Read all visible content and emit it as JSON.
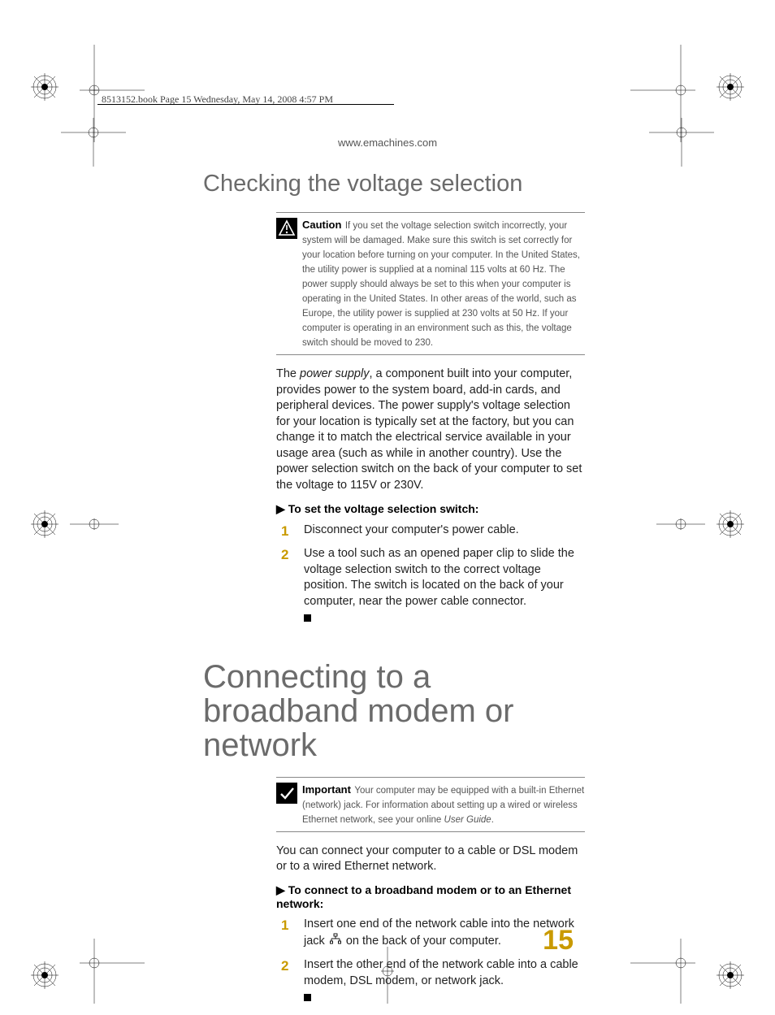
{
  "header": {
    "running": "8513152.book  Page 15  Wednesday, May 14, 2008  4:57 PM",
    "url": "www.emachines.com"
  },
  "section_voltage": {
    "title": "Checking the voltage selection",
    "callout": {
      "label": "Caution",
      "body_lead": " If you set the voltage selection switch incorrectly, your system will be damaged. Make sure this switch is set correctly for your location before turning on your computer. In the United States, the utility power is supplied at a nominal 115 volts at 60 Hz. The power supply should always be set to this when your computer is operating in the United States. In other areas of the world, such as Europe, the utility power is supplied at 230 volts at 50 Hz. If your computer is operating in an environment such as this, the voltage switch should be moved to 230."
    },
    "para_pre": "The ",
    "para_ital": "power supply",
    "para_post": ", a component built into your computer, provides power to the system board, add-in cards, and peripheral devices. The power supply's voltage selection for your location is typically set at the factory, but you can change it to match the electrical service available in your usage area (such as while in another country). Use the power selection switch on the back of your computer to set the voltage to 115V or 230V.",
    "proc_title": "To set the voltage selection switch:",
    "steps": [
      "Disconnect your computer's power cable.",
      "Use a tool such as an opened paper clip to slide the voltage selection switch to the correct voltage position. The switch is located on the back of your computer, near the power cable connector."
    ]
  },
  "section_network": {
    "title": "Connecting to a broadband modem or network",
    "callout": {
      "label": "Important",
      "body_pre": " Your computer may be equipped with a built-in Ethernet (network) jack. For information about setting up a wired or wireless Ethernet network, see your online ",
      "body_ital": "User Guide",
      "body_post": "."
    },
    "para": "You can connect your computer to a cable or DSL modem or to a wired Ethernet network.",
    "proc_title": "To connect to a broadband modem or to an Ethernet network:",
    "step1_pre": "Insert one end of the network cable into the network jack ",
    "step1_post": " on the back of your computer.",
    "step2": "Insert the other end of the network cable into a cable modem, DSL modem, or network jack."
  },
  "page_number": "15"
}
